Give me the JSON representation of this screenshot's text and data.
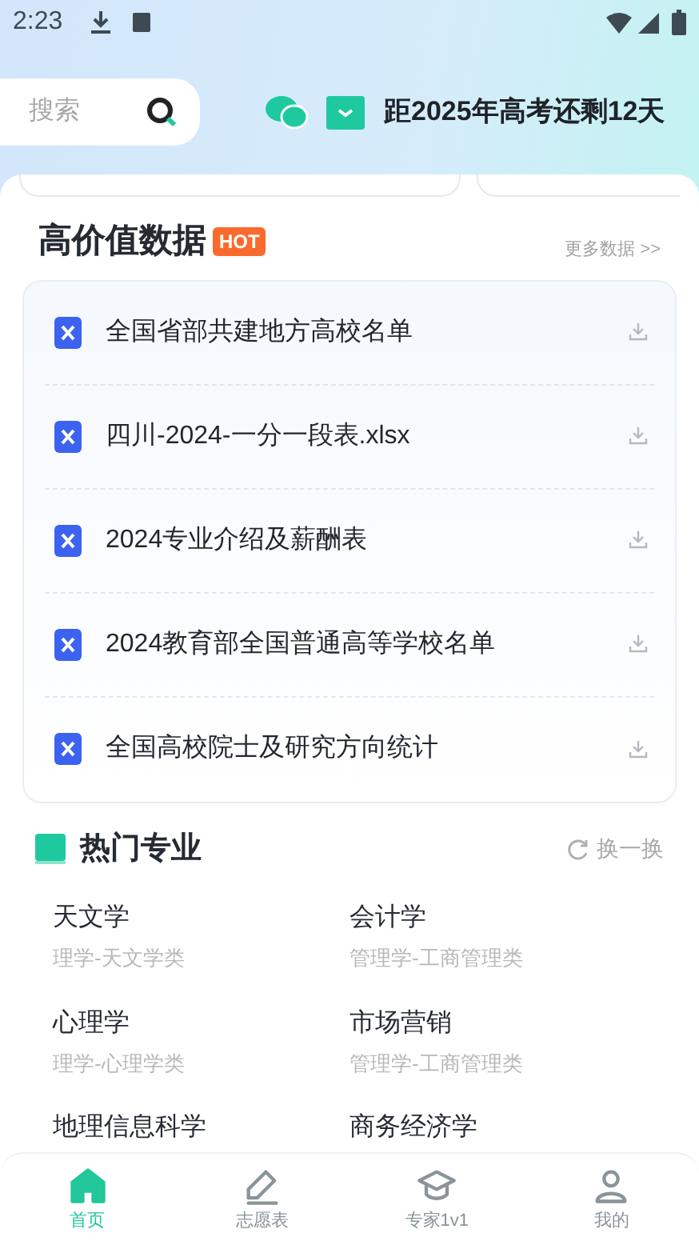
{
  "status_bar": {
    "time": "2:23"
  },
  "search": {
    "placeholder": "搜索"
  },
  "countdown": "距2025年高考还剩12天",
  "data_section": {
    "title": "高价值数据",
    "badge": "HOT",
    "more": "更多数据 >>",
    "files": [
      {
        "name": "全国省部共建地方高校名单"
      },
      {
        "name": "四川-2024-一分一段表.xlsx"
      },
      {
        "name": "2024专业介绍及薪酬表"
      },
      {
        "name": "2024教育部全国普通高等学校名单"
      },
      {
        "name": "全国高校院士及研究方向统计"
      }
    ]
  },
  "majors_section": {
    "title": "热门专业",
    "refresh": "换一换",
    "majors": [
      {
        "name": "天文学",
        "category": "理学-天文学类"
      },
      {
        "name": "会计学",
        "category": "管理学-工商管理类"
      },
      {
        "name": "心理学",
        "category": "理学-心理学类"
      },
      {
        "name": "市场营销",
        "category": "管理学-工商管理类"
      },
      {
        "name": "地理信息科学"
      },
      {
        "name": "商务经济学"
      }
    ]
  },
  "nav": [
    {
      "label": "首页",
      "selected": true,
      "kind": "home"
    },
    {
      "label": "志愿表",
      "selected": false,
      "kind": "edit"
    },
    {
      "label": "专家1v1",
      "selected": false,
      "kind": "expert"
    },
    {
      "label": "我的",
      "selected": false,
      "kind": "user"
    }
  ]
}
